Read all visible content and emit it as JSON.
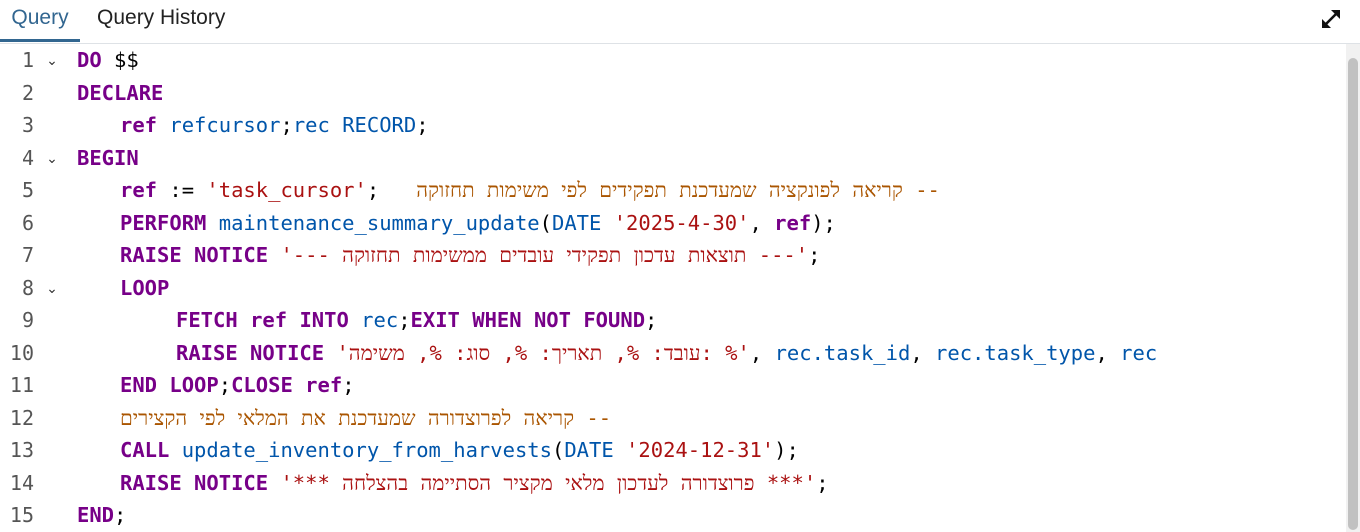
{
  "tabs": {
    "query": "Query",
    "history": "Query History"
  },
  "icons": {
    "expand": "expand-icon",
    "fold": "chevron-down-icon"
  },
  "line_numbers": [
    "1",
    "2",
    "3",
    "4",
    "5",
    "6",
    "7",
    "8",
    "9",
    "10",
    "11",
    "12",
    "13",
    "14",
    "15"
  ],
  "code": {
    "l1": {
      "kw": "DO",
      "rest": " $$"
    },
    "l2": {
      "kw": "DECLARE"
    },
    "l3": {
      "kw": "ref",
      "var1": "refcursor",
      "sep": ";",
      "var2": "rec",
      "var3": "RECORD",
      "end": ";"
    },
    "l5": {
      "kw": "ref",
      "op": " := ",
      "str": "'task_cursor'",
      "semi": ";",
      "comment": "-- קריאה לפונקציה שמעדכנת תפקידים לפי משימות תחזוקה"
    },
    "l6": {
      "kw": "PERFORM",
      "fn": "maintenance_summary_update",
      "p1": "(",
      "type": "DATE",
      "str": "'2025-4-30'",
      "comma": ", ",
      "ref": "ref",
      "end": ");"
    },
    "l7": {
      "kw": "RAISE NOTICE",
      "str": "'--- תוצאות עדכון תפקידי עובדים ממשימות תחזוקה ---'",
      "end": ";"
    },
    "l8": {
      "kw": "LOOP"
    },
    "l9": {
      "kw1": "FETCH",
      "kw2": "ref",
      "kw3": "INTO",
      "var": "rec",
      "sep": ";",
      "kw4": "EXIT WHEN NOT FOUND",
      "end": ";"
    },
    "l10": {
      "kw": "RAISE NOTICE",
      "str": "'עובד: %, תאריך: %, סוג: %, משימה: %'",
      "c1": ", ",
      "v1": "rec.task_id",
      "c2": ", ",
      "v2": "rec.task_type",
      "c3": ", ",
      "v3": "rec"
    },
    "l11": {
      "kw1": "END LOOP",
      "sep": ";",
      "kw2": "CLOSE",
      "kw3": "ref",
      "end": ";"
    },
    "l12": {
      "comment": "-- קריאה לפרוצדורה שמעדכנת את המלאי לפי הקצירים"
    },
    "l13": {
      "kw": "CALL",
      "fn": "update_inventory_from_harvests",
      "p1": "(",
      "type": "DATE",
      "str": "'2024-12-31'",
      "end": ");"
    },
    "l14": {
      "kw": "RAISE NOTICE",
      "str": "'*** פרוצדורה לעדכון מלאי מקציר הסתיימה בהצלחה ***'",
      "end": ";"
    },
    "l15": {
      "kw": "END",
      "end": ";"
    }
  }
}
